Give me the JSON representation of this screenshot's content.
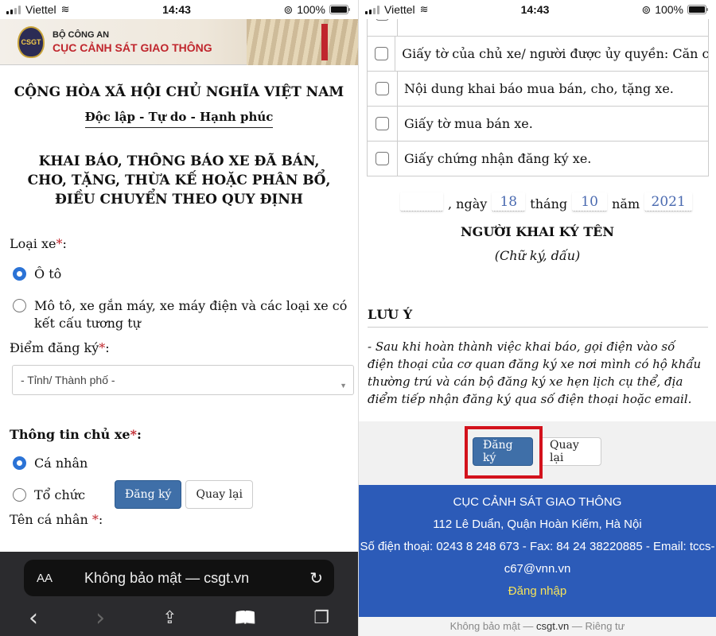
{
  "status": {
    "carrier": "Viettel",
    "time": "14:43",
    "battery": "100%"
  },
  "banner": {
    "logo_text": "CSGT",
    "ministry": "BỘ CÔNG AN",
    "agency": "CỤC CẢNH SÁT GIAO THÔNG"
  },
  "form": {
    "nation": "CỘNG HÒA XÃ HỘI CHỦ NGHĨA VIỆT NAM",
    "motto": "Độc lập - Tự do - Hạnh phúc",
    "title": "KHAI BÁO, THÔNG BÁO XE ĐÃ BÁN, CHO, TẶNG, THỪA KẾ HOẶC PHÂN BỔ, ĐIỀU CHUYỂN THEO QUY ĐỊNH",
    "vehicle_type_label": "Loại xe",
    "vehicle_type_options": [
      {
        "label": "Ô tô",
        "selected": true
      },
      {
        "label": "Mô tô, xe gắn máy, xe máy điện và các loại xe có kết cấu tương tự",
        "selected": false
      }
    ],
    "reg_point_label": "Điểm đăng ký",
    "province_placeholder": "- Tỉnh/ Thành phố -",
    "owner_info_label": "Thông tin chủ xe",
    "owner_options": [
      {
        "label": "Cá nhân",
        "selected": true
      },
      {
        "label": "Tổ chức",
        "selected": false
      }
    ],
    "person_name_label": "Tên cá nhân",
    "required_mark": "*",
    "colon": ":"
  },
  "buttons": {
    "register": "Đăng ký",
    "back": "Quay lại"
  },
  "safari": {
    "aa": "AA",
    "url": "Không bảo mật — csgt.vn",
    "reload": "↻",
    "back": "‹",
    "forward": "›",
    "share": "⇪",
    "bookmarks": "📖",
    "tabs": "❐"
  },
  "documents": [
    "Giấy tờ của chủ xe/ người được ủy quyền: Căn cước",
    "Nội dung khai báo mua bán, cho, tặng xe.",
    "Giấy tờ mua bán xe.",
    "Giấy chứng nhận đăng ký xe."
  ],
  "date": {
    "location": "",
    "day_label": ", ngày",
    "day": "18",
    "month_label": "tháng",
    "month": "10",
    "year_label": "năm",
    "year": "2021"
  },
  "signer": {
    "title": "NGƯỜI KHAI KÝ TÊN",
    "subtitle": "(Chữ ký, dấu)"
  },
  "note": {
    "title": "LƯU Ý",
    "body": "- Sau khi hoàn thành việc khai báo, gọi điện vào số điện thoại của cơ quan đăng ký xe nơi mình có hộ khẩu thường trú và cán bộ đăng ký xe hẹn lịch cụ thể, địa điểm tiếp nhận đăng ký qua số điện thoại hoặc email."
  },
  "footer": {
    "agency": "CỤC CẢNH SÁT GIAO THÔNG",
    "address": "112 Lê Duẩn, Quận Hoàn Kiếm, Hà Nội",
    "contact_line1": "Số điện thoại: 0243 8 248 673 - Fax: 84 24 38220885 - Email: tccs-",
    "contact_line2": "c67@vnn.vn",
    "login": "Đăng nhập"
  },
  "bottom_url": {
    "prefix": "Không bảo mật — ",
    "domain": "csgt.vn",
    "suffix": " — Riêng tư"
  },
  "colors": {
    "primary_button": "#3f6fa8",
    "footer_bg": "#2c5bb8",
    "required": "#c0262d",
    "highlight": "#d3121c",
    "radio_on": "#2b73d6"
  }
}
